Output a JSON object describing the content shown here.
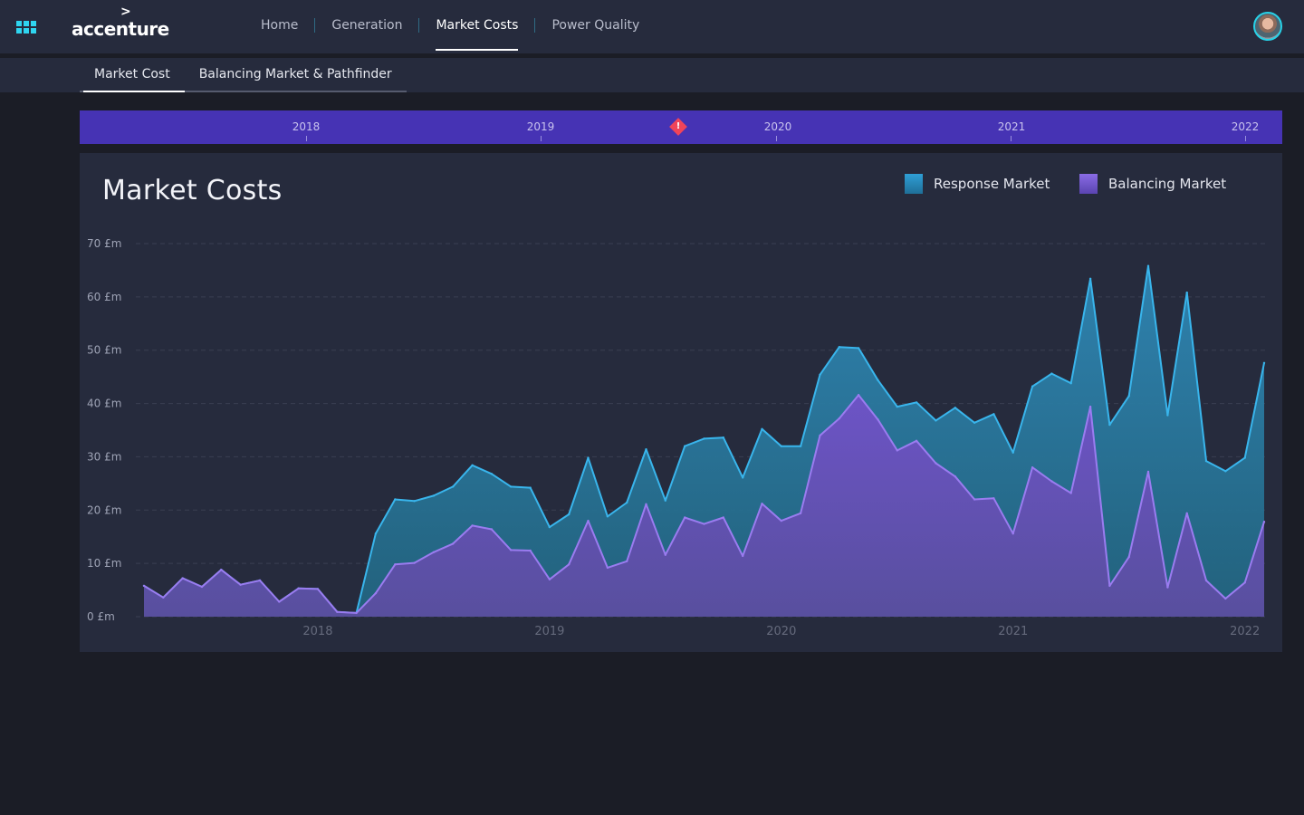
{
  "header": {
    "brand": "accenture",
    "nav": [
      {
        "label": "Home",
        "active": false
      },
      {
        "label": "Generation",
        "active": false
      },
      {
        "label": "Market Costs",
        "active": true
      },
      {
        "label": "Power Quality",
        "active": false
      }
    ]
  },
  "subnav": {
    "tabs": [
      {
        "label": "Market Cost",
        "active": true
      },
      {
        "label": "Balancing Market & Pathfinder",
        "active": false
      }
    ]
  },
  "timeline": {
    "years": [
      "2018",
      "2019",
      "2020",
      "2021",
      "2022"
    ],
    "alert_icon": "warning-diamond-icon",
    "color": "#4633b4"
  },
  "panel": {
    "title": "Market Costs",
    "legend": [
      {
        "label": "Response Market",
        "color": "#2b9ad0"
      },
      {
        "label": "Balancing Market",
        "color": "#7b5fd8"
      }
    ]
  },
  "chart_data": {
    "type": "area",
    "title": "Market Costs",
    "y_unit": "£m",
    "ylim": [
      0,
      70
    ],
    "y_ticks": [
      "0 £m",
      "10 £m",
      "20 £m",
      "30 £m",
      "40 £m",
      "50 £m",
      "60 £m",
      "70 £m"
    ],
    "x_tick_labels": [
      "2018",
      "2019",
      "2020",
      "2021",
      "2022"
    ],
    "x_start": "2017-04",
    "x_end": "2022-02",
    "grid": true,
    "legend_position": "top-right",
    "x": [
      "2017-04",
      "2017-05",
      "2017-06",
      "2017-07",
      "2017-08",
      "2017-09",
      "2017-10",
      "2017-11",
      "2017-12",
      "2018-01",
      "2018-02",
      "2018-03",
      "2018-04",
      "2018-05",
      "2018-06",
      "2018-07",
      "2018-08",
      "2018-09",
      "2018-10",
      "2018-11",
      "2018-12",
      "2019-01",
      "2019-02",
      "2019-03",
      "2019-04",
      "2019-05",
      "2019-06",
      "2019-07",
      "2019-08",
      "2019-09",
      "2019-10",
      "2019-11",
      "2019-12",
      "2020-01",
      "2020-02",
      "2020-03",
      "2020-04",
      "2020-05",
      "2020-06",
      "2020-07",
      "2020-08",
      "2020-09",
      "2020-10",
      "2020-11",
      "2020-12",
      "2021-01",
      "2021-02",
      "2021-03",
      "2021-04",
      "2021-05",
      "2021-06",
      "2021-07",
      "2021-08",
      "2021-09",
      "2021-10",
      "2021-11",
      "2021-12",
      "2022-01",
      "2022-02"
    ],
    "series": [
      {
        "name": "Response Market",
        "color": "#2b9ad0",
        "values": [
          5.8,
          3.6,
          7.2,
          5.6,
          8.8,
          6.0,
          6.8,
          2.8,
          5.3,
          5.2,
          0.9,
          0.7,
          15.6,
          22.0,
          21.7,
          22.7,
          24.4,
          28.4,
          26.8,
          24.4,
          24.2,
          16.8,
          19.2,
          29.8,
          18.8,
          21.4,
          31.4,
          21.8,
          32.0,
          33.4,
          33.6,
          26.1,
          35.2,
          32.0,
          32.0,
          45.4,
          50.6,
          50.4,
          44.4,
          39.4,
          40.2,
          36.8,
          39.2,
          36.4,
          38.0,
          30.8,
          43.2,
          45.6,
          43.8,
          63.4,
          36.0,
          41.4,
          65.8,
          37.8,
          60.8,
          29.2,
          27.3,
          29.8,
          47.6
        ]
      },
      {
        "name": "Balancing Market",
        "color": "#7b5fd8",
        "values": [
          5.8,
          3.6,
          7.2,
          5.6,
          8.8,
          6.0,
          6.8,
          2.8,
          5.3,
          5.2,
          0.9,
          0.7,
          4.4,
          9.8,
          10.1,
          12.1,
          13.7,
          17.1,
          16.4,
          12.5,
          12.4,
          7.0,
          9.8,
          18.0,
          9.2,
          10.4,
          21.1,
          11.6,
          18.6,
          17.4,
          18.6,
          11.4,
          21.2,
          18.0,
          19.4,
          34.0,
          37.2,
          41.6,
          37.0,
          31.2,
          33.0,
          28.8,
          26.3,
          22.0,
          22.2,
          15.6,
          28.0,
          25.4,
          23.2,
          39.4,
          5.8,
          11.2,
          27.2,
          5.5,
          19.4,
          6.8,
          3.4,
          6.4,
          17.8
        ]
      }
    ]
  }
}
